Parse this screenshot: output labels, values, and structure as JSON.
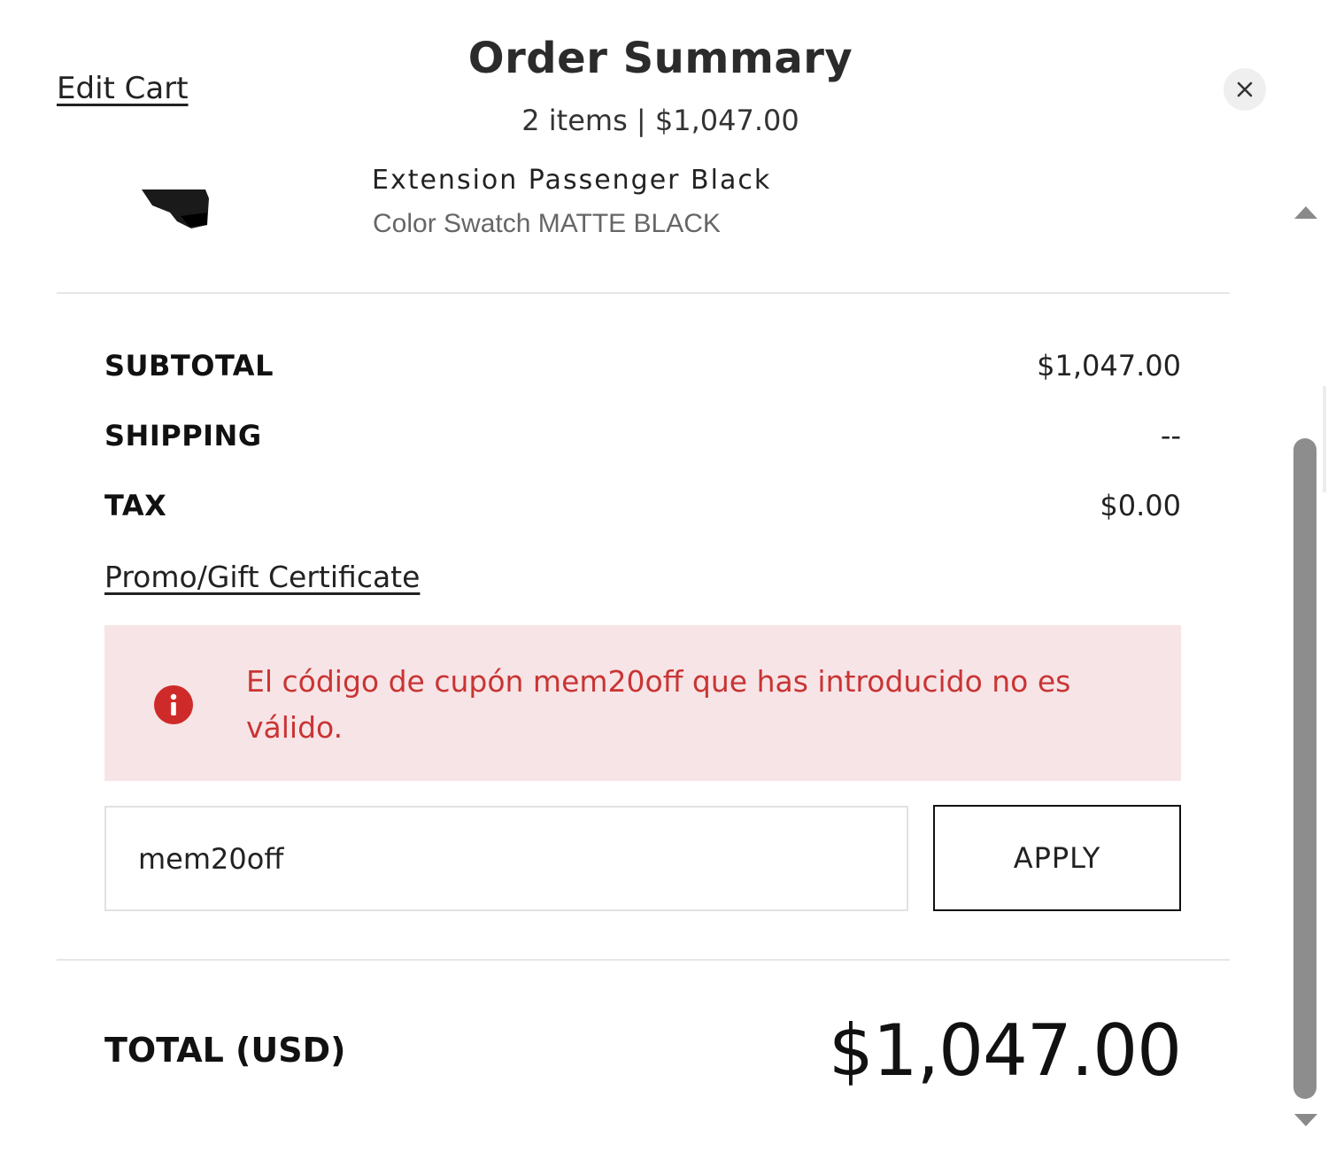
{
  "header": {
    "edit_cart": "Edit Cart",
    "title": "Order Summary",
    "subtitle": "2 items | $1,047.00",
    "close_icon": "close-icon"
  },
  "item": {
    "name_partial": "Extension Passenger Black",
    "variant": "Color Swatch MATTE BLACK"
  },
  "summary": {
    "subtotal_label": "SUBTOTAL",
    "subtotal_value": "$1,047.00",
    "shipping_label": "SHIPPING",
    "shipping_value": "--",
    "tax_label": "TAX",
    "tax_value": "$0.00",
    "promo_link": "Promo/Gift Certificate"
  },
  "alert": {
    "icon": "error-icon",
    "message": "El código de cupón mem20off que has introducido no es válido.",
    "color": "#c93434",
    "background": "#f7e4e6"
  },
  "promo": {
    "input_value": "mem20off",
    "apply_label": "APPLY"
  },
  "total": {
    "label": "TOTAL (USD)",
    "value": "$1,047.00"
  }
}
